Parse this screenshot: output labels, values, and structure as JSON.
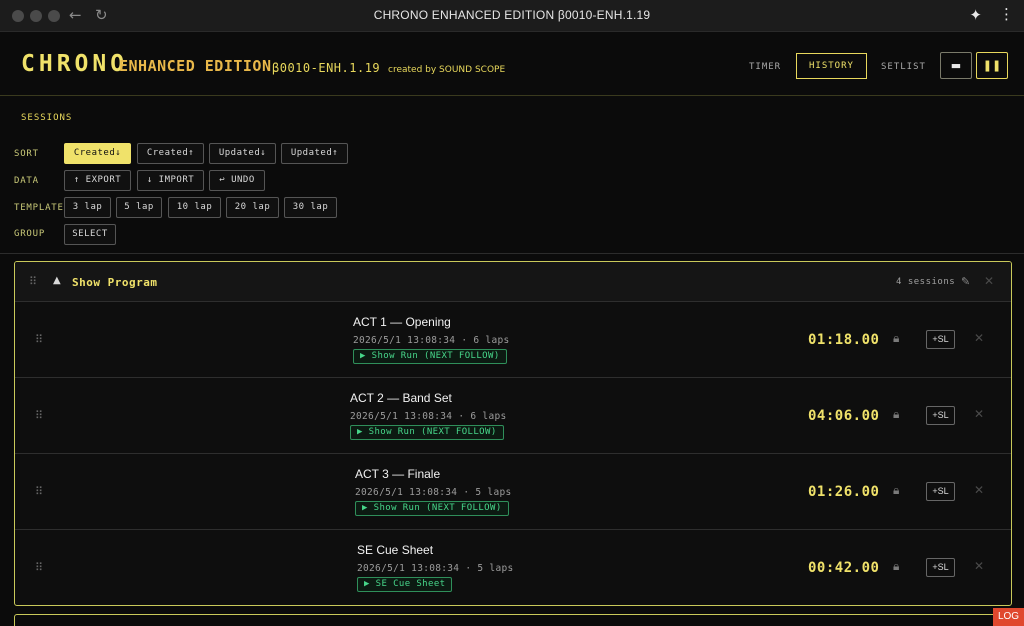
{
  "window": {
    "title": "CHRONO ENHANCED EDITION β0010-ENH.1.19",
    "back_icon": "arrow-left-icon",
    "reload_icon": "reload-icon",
    "extensions_icon": "puzzle-icon",
    "menu_icon": "kebab-menu-icon"
  },
  "header": {
    "logo": "CHRONO",
    "edition": "ENHANCED EDITION",
    "version": "β0010-ENH.1.19",
    "credit": "created by SOUND SCOPE",
    "tabs": [
      {
        "label": "TIMER",
        "active": false
      },
      {
        "label": "HISTORY",
        "active": true
      },
      {
        "label": "SETLIST",
        "active": false
      }
    ],
    "keyboard_icon": "keyboard-icon",
    "pause_icon": "pause-icon"
  },
  "sessions": {
    "label": "SESSIONS",
    "sort": {
      "label": "SORT",
      "options": [
        "Created↓",
        "Created↑",
        "Updated↓",
        "Updated↑"
      ],
      "selected": "Created↓"
    },
    "data": {
      "label": "DATA",
      "export": "↑ EXPORT",
      "import": "↓ IMPORT",
      "undo": "↩ UNDO"
    },
    "template": {
      "label": "TEMPLATE",
      "options": [
        "3 lap",
        "5 lap",
        "10 lap",
        "20 lap",
        "30 lap"
      ]
    },
    "group": {
      "label": "GROUP",
      "select": "SELECT"
    }
  },
  "group_panel": {
    "name": "Show Program",
    "count": "4 sessions",
    "items": [
      {
        "title": "ACT 1 — Opening",
        "meta": "2026/5/1 13:08:34 · 6 laps",
        "badge": "▶ Show Run (NEXT FOLLOW)",
        "time": "01:18.00",
        "sl": "+SL"
      },
      {
        "title": "ACT 2 — Band Set",
        "meta": "2026/5/1 13:08:34 · 6 laps",
        "badge": "▶ Show Run (NEXT FOLLOW)",
        "time": "04:06.00",
        "sl": "+SL"
      },
      {
        "title": "ACT 3 — Finale",
        "meta": "2026/5/1 13:08:34 · 5 laps",
        "badge": "▶ Show Run (NEXT FOLLOW)",
        "time": "01:26.00",
        "sl": "+SL"
      },
      {
        "title": "SE Cue Sheet",
        "meta": "2026/5/1 13:08:34 · 5 laps",
        "badge": "▶ SE Cue Sheet",
        "time": "00:42.00",
        "sl": "+SL"
      }
    ]
  },
  "log_button": "LOG",
  "colors": {
    "accent_yellow": "#f0e26a",
    "edition_orange": "#e9b84a",
    "badge_green": "#47d68a",
    "log_red": "#e0482e",
    "background": "#0b0b0b"
  }
}
